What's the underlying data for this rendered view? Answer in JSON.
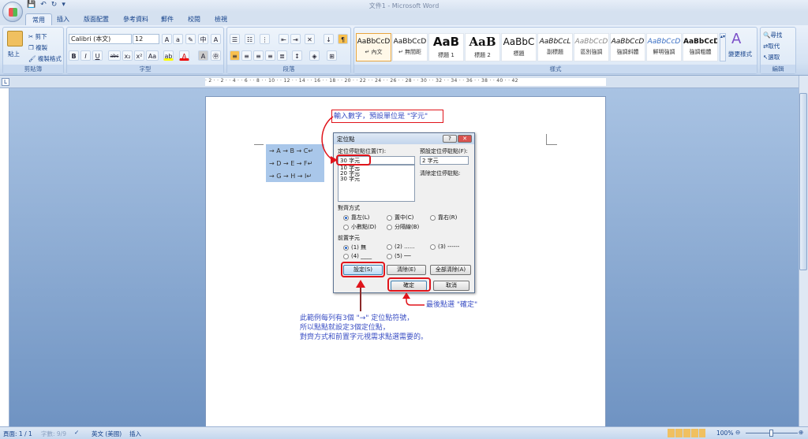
{
  "window": {
    "title": "文件1 - Microsoft Word"
  },
  "qat": {
    "save": "💾",
    "undo": "↶",
    "redo": "↻",
    "customize": "▾"
  },
  "tabs": [
    "常用",
    "插入",
    "版面配置",
    "參考資料",
    "郵件",
    "校閱",
    "檢視"
  ],
  "clipboard": {
    "paste": "貼上",
    "cut": "剪下",
    "copy": "複製",
    "format_painter": "複製格式",
    "label": "剪貼簿"
  },
  "font": {
    "name": "Calibri (本文)",
    "size": "12",
    "label": "字型",
    "buttons": [
      "B",
      "I",
      "U",
      "abc",
      "x₂",
      "x²",
      "Aa",
      "A"
    ]
  },
  "paragraph": {
    "label": "段落"
  },
  "styles": {
    "label": "樣式",
    "items": [
      {
        "sample": "AaBbCcD",
        "name": "↵ 內文"
      },
      {
        "sample": "AaBbCcD",
        "name": "↵ 無間距"
      },
      {
        "sample": "AaB",
        "name": "標題 1"
      },
      {
        "sample": "AaB",
        "name": "標題 2"
      },
      {
        "sample": "AaBbC",
        "name": "標題"
      },
      {
        "sample": "AaBbCcL",
        "name": "副標題"
      },
      {
        "sample": "AaBbCcD",
        "name": "區別強調"
      },
      {
        "sample": "AaBbCcD",
        "name": "強調斜體"
      },
      {
        "sample": "AaBbCcD",
        "name": "鮮明強調"
      },
      {
        "sample": "AaBbCcD",
        "name": "強調粗體"
      }
    ],
    "change": "變更樣式"
  },
  "editing": {
    "label": "編輯",
    "find": "尋找",
    "replace": "取代",
    "select": "選取"
  },
  "ruler": "· 2 · · 2 · · 4 · · 6 · · 8 · · 10 · · 12 · · 14 · · 16 · · 18 · · 20 · · 22 · · 24 · · 26 · · 28 · · 30 · · 32 · · 34 · · 36 · · 38 · · 40 · · 42",
  "document": {
    "rows": [
      "→  A → B → C↵",
      "→  D → E → F↵",
      "→  G → H → I↵"
    ]
  },
  "dialog": {
    "title": "定位點",
    "help": "?",
    "close": "✕",
    "tab_stop_label": "定位停駐點位置(T):",
    "tab_stop_value": "30 字元",
    "list": [
      "10 字元",
      "20 字元",
      "30 字元"
    ],
    "default_label": "預設定位停駐點(F):",
    "default_value": "2 字元",
    "clear_label": "清除定位停駐點:",
    "alignment_label": "對齊方式",
    "alignment": [
      "靠左(L)",
      "置中(C)",
      "靠右(R)",
      "小數點(D)",
      "分隔線(B)"
    ],
    "leader_label": "前置字元",
    "leaders": [
      "(1) 無",
      "(2) ......",
      "(3) ------",
      "(4) ____",
      "(5) ──"
    ],
    "set": "設定(S)",
    "clear": "清除(E)",
    "clear_all": "全部清除(A)",
    "ok": "確定",
    "cancel": "取消"
  },
  "annotations": {
    "top": "輸入數字，預設單位是 \"字元\"",
    "right": "最後點選 \"確定\"",
    "bottom": [
      "此範例每列有3個 \"→\" 定位點符號，",
      "所以點點就設定3個定位點，",
      "對齊方式和前置字元視需求點選需要的。"
    ]
  },
  "status": {
    "page": "頁面: 1 / 1",
    "words": "字數: 9/9",
    "language": "英文 (美國)",
    "mode": "插入",
    "zoom": "100%"
  },
  "colors": {
    "accent": "#e0141b",
    "note": "#3b4fc4"
  }
}
